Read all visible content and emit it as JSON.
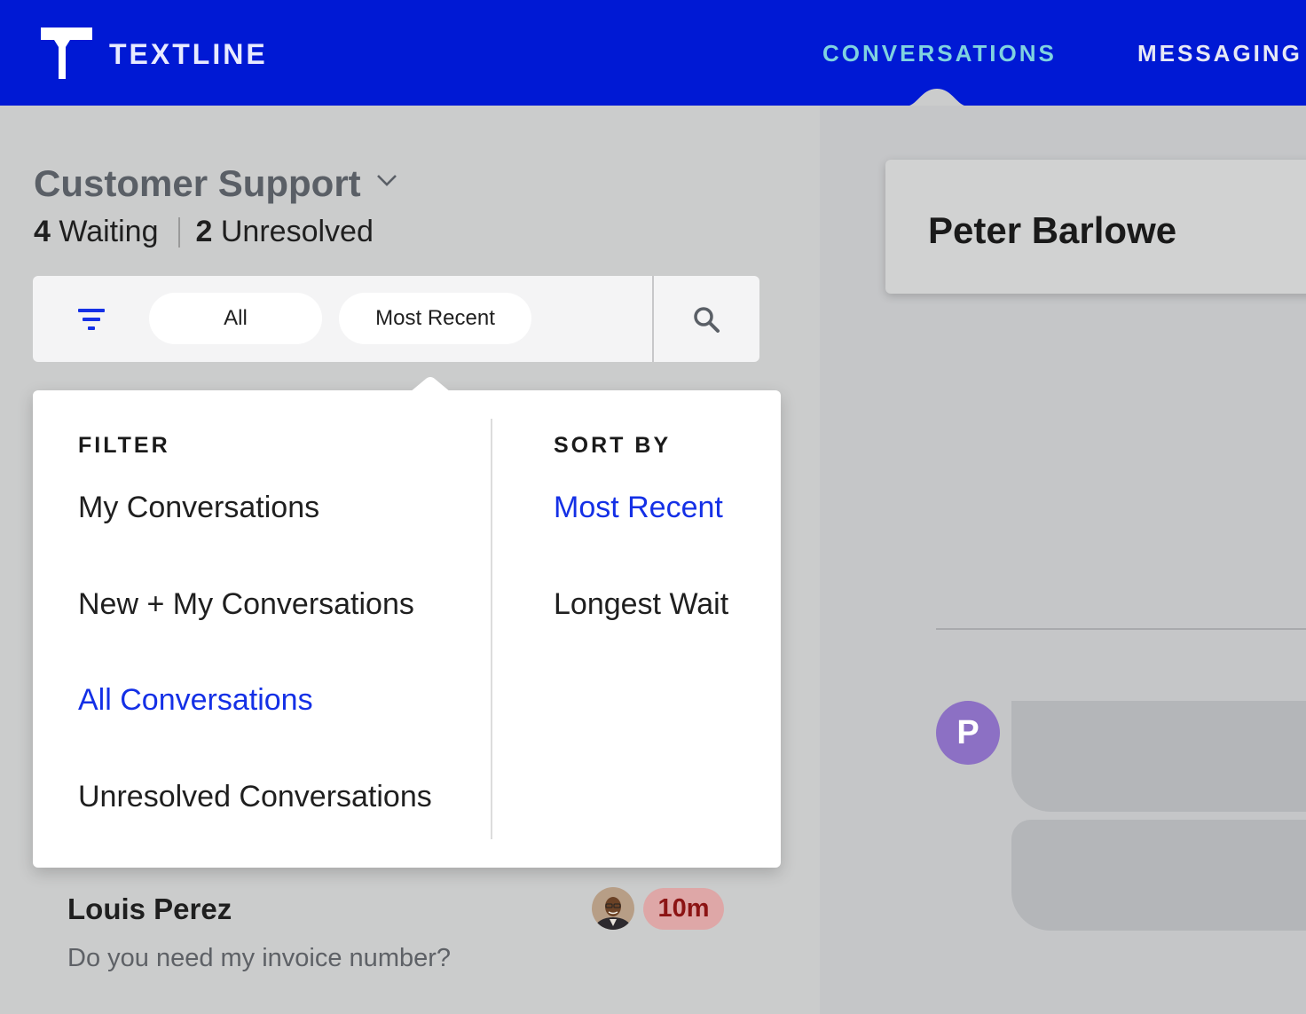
{
  "app": {
    "brand": "TEXTLINE",
    "nav": {
      "conversations": "CONVERSATIONS",
      "messaging": "MESSAGING"
    },
    "colors": {
      "nav_bg": "#0019d4",
      "active_nav": "#7fd2e0",
      "link_active": "#1430e6",
      "wait_badge_bg": "#dea7a7",
      "wait_badge_text": "#8c1414",
      "avatar_purple": "#8c70c4"
    }
  },
  "inbox": {
    "title": "Customer Support",
    "waiting_count": "4",
    "waiting_label": "Waiting",
    "unresolved_count": "2",
    "unresolved_label": "Unresolved"
  },
  "toolbar": {
    "filter_icon": "filter-icon",
    "filter_value": "All",
    "sort_value": "Most Recent",
    "search_icon": "search-icon"
  },
  "dropdown": {
    "filter_heading": "FILTER",
    "filter_options": [
      {
        "label": "My Conversations",
        "active": false
      },
      {
        "label": "New + My Conversations",
        "active": false
      },
      {
        "label": "All Conversations",
        "active": true
      },
      {
        "label": "Unresolved Conversations",
        "active": false
      }
    ],
    "sort_heading": "SORT BY",
    "sort_options": [
      {
        "label": "Most Recent",
        "active": true
      },
      {
        "label": "Longest Wait",
        "active": false
      }
    ]
  },
  "conversation": {
    "name": "Louis Perez",
    "preview": "Do you need my invoice number?",
    "wait_time": "10m"
  },
  "contact": {
    "name": "Peter Barlowe",
    "avatar_initial": "P"
  }
}
